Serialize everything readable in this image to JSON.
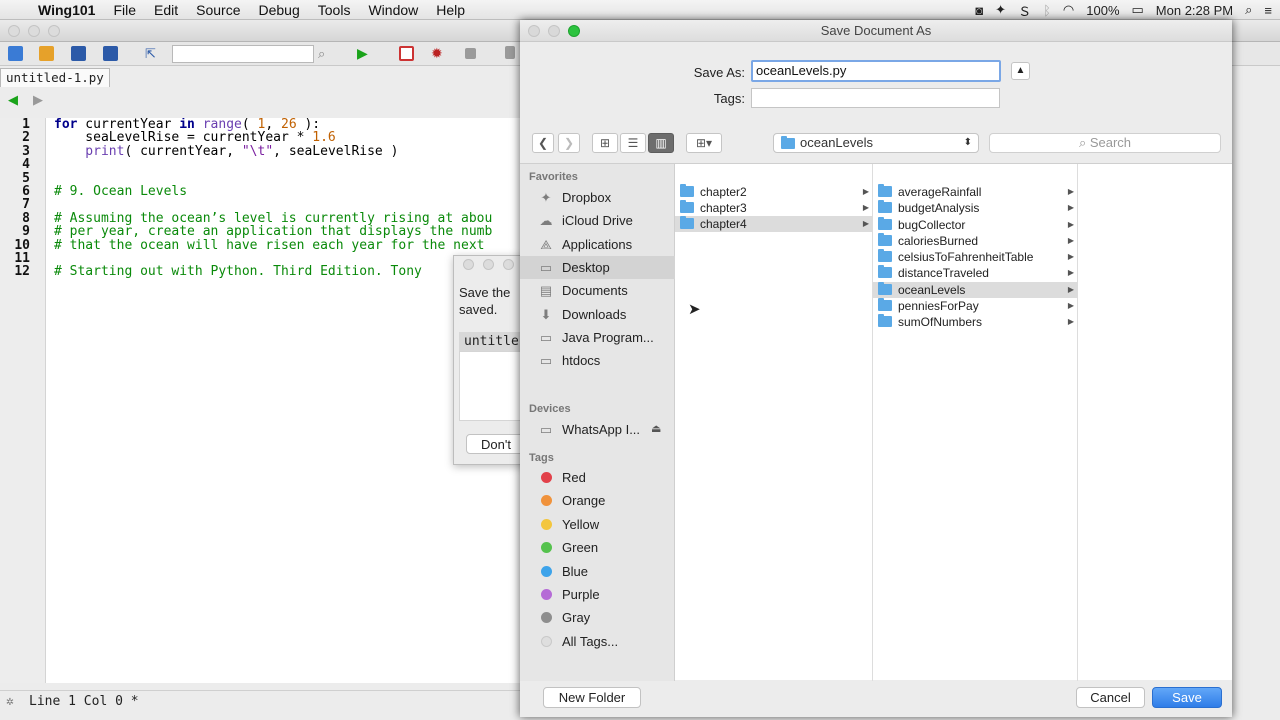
{
  "menubar": {
    "app": "Wing101",
    "items": [
      "File",
      "Edit",
      "Source",
      "Debug",
      "Tools",
      "Window",
      "Help"
    ],
    "battery": "100%",
    "clock": "Mon 2:28 PM"
  },
  "ide": {
    "tab": "untitled-1.py",
    "status": "Line 1 Col 0 *",
    "line_numbers": [
      "1",
      "2",
      "3",
      "4",
      "5",
      "6",
      "7",
      "8",
      "9",
      "10",
      "11",
      "12"
    ],
    "code": {
      "l1": {
        "kw1": "for",
        "a": " currentYear ",
        "kw2": "in",
        "b": " ",
        "fn": "range",
        "c": "( ",
        "n1": "1",
        ",": ", ",
        "n2": "26",
        "d": " ):"
      },
      "l2": {
        "a": "    seaLevelRise = currentYear * ",
        "n": "1.6"
      },
      "l3": {
        "fn": "    print",
        "a": "( currentYear, ",
        "s": "\"\\t\"",
        "b": ", seaLevelRise )"
      },
      "l6": "# 9. Ocean Levels",
      "l8": "# Assuming the ocean’s level is currently rising at abou",
      "l9": "# per year, create an application that displays the numb",
      "l10": "# that the ocean will have risen each year for the next",
      "l12": "# Starting out with Python. Third Edition. Tony"
    },
    "bg_dialog": {
      "msg_line1": "Save the",
      "msg_line2": "saved.",
      "field": "untitle",
      "button": "Don't"
    }
  },
  "sheet": {
    "title": "Save Document As",
    "save_as_label": "Save As:",
    "save_as_value": "oceanLevels.py",
    "tags_label": "Tags:",
    "location": "oceanLevels",
    "search_placeholder": "Search",
    "sidebar": {
      "favorites_header": "Favorites",
      "favorites": [
        "Dropbox",
        "iCloud Drive",
        "Applications",
        "Desktop",
        "Documents",
        "Downloads",
        "Java Program...",
        "htdocs"
      ],
      "devices_header": "Devices",
      "devices": [
        "WhatsApp I..."
      ],
      "tags_header": "Tags",
      "tags": [
        {
          "name": "Red",
          "color": "#e2414a"
        },
        {
          "name": "Orange",
          "color": "#f0923b"
        },
        {
          "name": "Yellow",
          "color": "#f3c63d"
        },
        {
          "name": "Green",
          "color": "#55c24d"
        },
        {
          "name": "Blue",
          "color": "#3da3ea"
        },
        {
          "name": "Purple",
          "color": "#b56bd6"
        },
        {
          "name": "Gray",
          "color": "#8e8e8e"
        },
        {
          "name": "All Tags...",
          "color": "#dedede"
        }
      ]
    },
    "col1": [
      "chapter2",
      "chapter3",
      "chapter4"
    ],
    "col2": [
      "averageRainfall",
      "budgetAnalysis",
      "bugCollector",
      "caloriesBurned",
      "celsiusToFahrenheitTable",
      "distanceTraveled",
      "oceanLevels",
      "penniesForPay",
      "sumOfNumbers"
    ],
    "new_folder": "New Folder",
    "cancel": "Cancel",
    "save": "Save"
  }
}
